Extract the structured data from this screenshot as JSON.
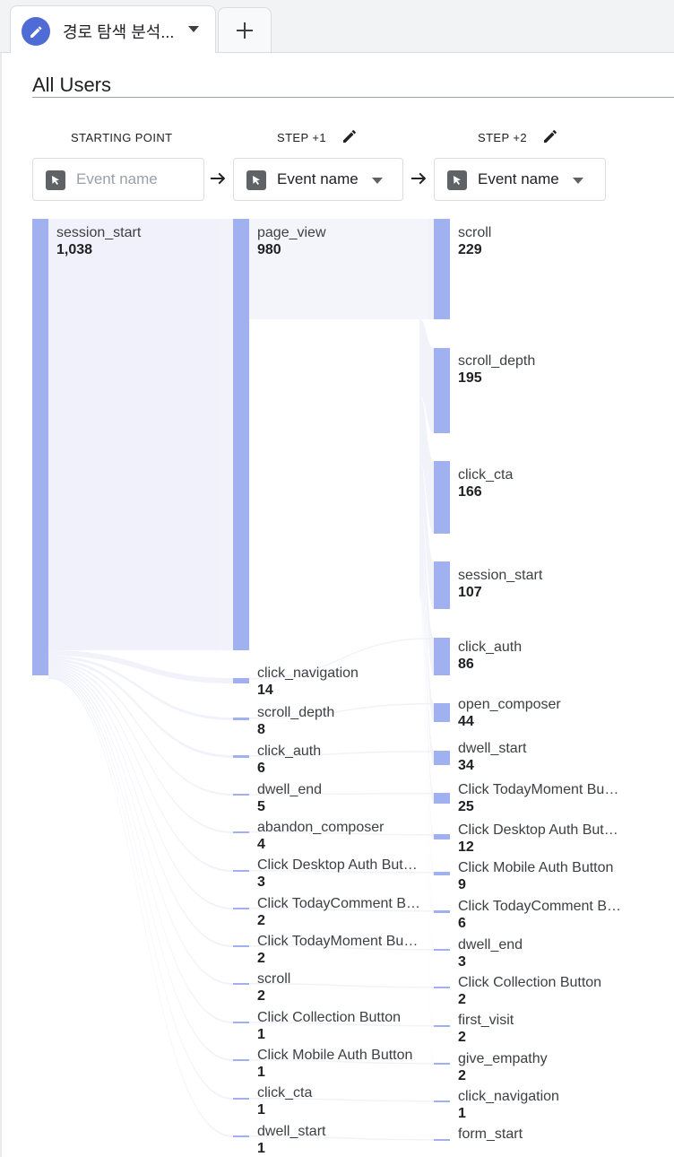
{
  "tab": {
    "title": "경로 탐색 분석...",
    "add_label": "+"
  },
  "segment": "All Users",
  "columns": [
    {
      "label": "STARTING POINT",
      "picker": "Event name",
      "placeholder": true
    },
    {
      "label": "STEP +1",
      "picker": "Event name",
      "placeholder": false
    },
    {
      "label": "STEP +2",
      "picker": "Event name",
      "placeholder": false
    }
  ],
  "colors": {
    "node": "#a1b0ee",
    "flow": "#eef0f9",
    "node_bg": "#f4f5fa"
  },
  "starting_point": {
    "label": "session_start",
    "value": "1,038"
  },
  "step1": [
    {
      "label": "page_view",
      "value": "980"
    },
    {
      "label": "click_navigation",
      "value": "14"
    },
    {
      "label": "scroll_depth",
      "value": "8"
    },
    {
      "label": "click_auth",
      "value": "6"
    },
    {
      "label": "dwell_end",
      "value": "5"
    },
    {
      "label": "abandon_composer",
      "value": "4"
    },
    {
      "label": "Click Desktop Auth Button",
      "value": "3"
    },
    {
      "label": "Click TodayComment Button",
      "value": "2"
    },
    {
      "label": "Click TodayMoment Button",
      "value": "2"
    },
    {
      "label": "scroll",
      "value": "2"
    },
    {
      "label": "Click Collection Button",
      "value": "1"
    },
    {
      "label": "Click Mobile Auth Button",
      "value": "1"
    },
    {
      "label": "click_cta",
      "value": "1"
    },
    {
      "label": "dwell_start",
      "value": "1"
    }
  ],
  "step2": [
    {
      "label": "scroll",
      "value": "229"
    },
    {
      "label": "scroll_depth",
      "value": "195"
    },
    {
      "label": "click_cta",
      "value": "166"
    },
    {
      "label": "session_start",
      "value": "107"
    },
    {
      "label": "click_auth",
      "value": "86"
    },
    {
      "label": "open_composer",
      "value": "44"
    },
    {
      "label": "dwell_start",
      "value": "34"
    },
    {
      "label": "Click TodayMoment Button",
      "value": "25"
    },
    {
      "label": "Click Desktop Auth Button",
      "value": "12"
    },
    {
      "label": "Click Mobile Auth Button",
      "value": "9"
    },
    {
      "label": "Click TodayComment Button",
      "value": "6"
    },
    {
      "label": "dwell_end",
      "value": "3"
    },
    {
      "label": "Click Collection Button",
      "value": "2"
    },
    {
      "label": "first_visit",
      "value": "2"
    },
    {
      "label": "give_empathy",
      "value": "2"
    },
    {
      "label": "click_navigation",
      "value": "1"
    },
    {
      "label": "form_start",
      "value": ""
    }
  ]
}
